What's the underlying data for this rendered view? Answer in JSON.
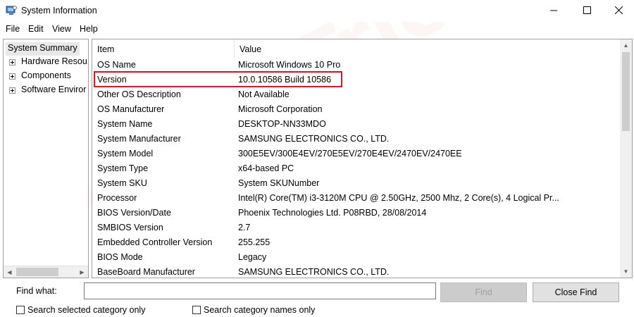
{
  "window": {
    "title": "System Information"
  },
  "menu": [
    "File",
    "Edit",
    "View",
    "Help"
  ],
  "tree": {
    "root": "System Summary",
    "items": [
      "Hardware Resou",
      "Components",
      "Software Enviror"
    ]
  },
  "table": {
    "columns": {
      "item": "Item",
      "value": "Value"
    },
    "rows": [
      {
        "item": "OS Name",
        "value": "Microsoft Windows 10 Pro"
      },
      {
        "item": "Version",
        "value": "10.0.10586 Build 10586"
      },
      {
        "item": "Other OS Description",
        "value": "Not Available"
      },
      {
        "item": "OS Manufacturer",
        "value": "Microsoft Corporation"
      },
      {
        "item": "System Name",
        "value": "DESKTOP-NN33MDO"
      },
      {
        "item": "System Manufacturer",
        "value": "SAMSUNG ELECTRONICS CO., LTD."
      },
      {
        "item": "System Model",
        "value": "300E5EV/300E4EV/270E5EV/270E4EV/2470EV/2470EE"
      },
      {
        "item": "System Type",
        "value": "x64-based PC"
      },
      {
        "item": "System SKU",
        "value": "System SKUNumber"
      },
      {
        "item": "Processor",
        "value": "Intel(R) Core(TM) i3-3120M CPU @ 2.50GHz, 2500 Mhz, 2 Core(s), 4 Logical Pr..."
      },
      {
        "item": "BIOS Version/Date",
        "value": "Phoenix Technologies Ltd. P08RBD, 28/08/2014"
      },
      {
        "item": "SMBIOS Version",
        "value": "2.7"
      },
      {
        "item": "Embedded Controller Version",
        "value": "255.255"
      },
      {
        "item": "BIOS Mode",
        "value": "Legacy"
      },
      {
        "item": "BaseBoard Manufacturer",
        "value": "SAMSUNG ELECTRONICS CO., LTD."
      }
    ],
    "highlighted_row": "Version",
    "highlight_color": "#e3141b"
  },
  "find": {
    "label": "Find what:",
    "value": "",
    "find_button": "Find",
    "close_button": "Close Find",
    "options": [
      "Search selected category only",
      "Search category names only"
    ]
  },
  "watermark": "DeviceTricks",
  "icons": {
    "minimize": "minimize-icon",
    "maximize": "maximize-icon",
    "close": "close-icon",
    "app": "system-information-icon"
  }
}
